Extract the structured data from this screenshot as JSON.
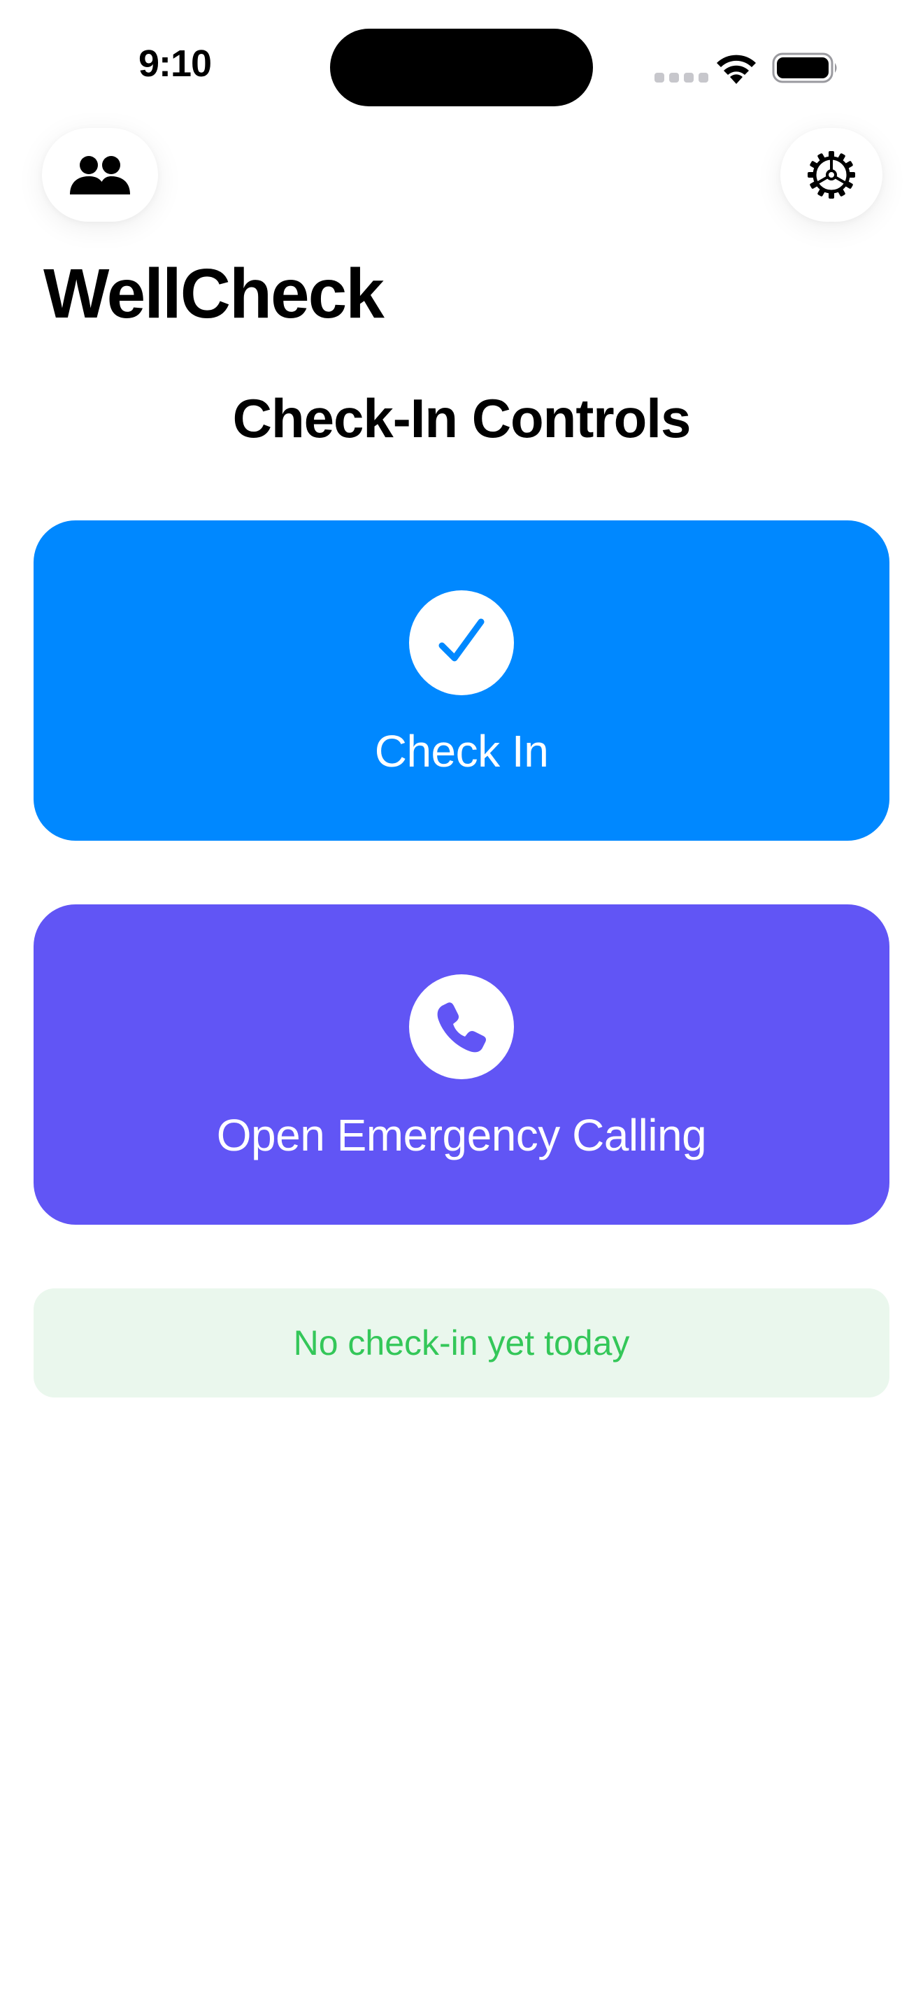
{
  "status_bar": {
    "time": "9:10",
    "icons": [
      "cellular-signal-icon",
      "wifi-icon",
      "battery-icon"
    ]
  },
  "toolbar": {
    "left_icon": "people-icon",
    "right_icon": "gear-icon"
  },
  "header": {
    "app_title": "WellCheck",
    "section_title": "Check-In Controls"
  },
  "actions": {
    "check_in": {
      "label": "Check In",
      "icon": "checkmark-icon",
      "color": "#0088ff"
    },
    "emergency": {
      "label": "Open Emergency Calling",
      "icon": "phone-icon",
      "color": "#6155f5"
    }
  },
  "status": {
    "text": "No check-in yet today",
    "text_color": "#34c759",
    "background": "#eaf7ed"
  }
}
